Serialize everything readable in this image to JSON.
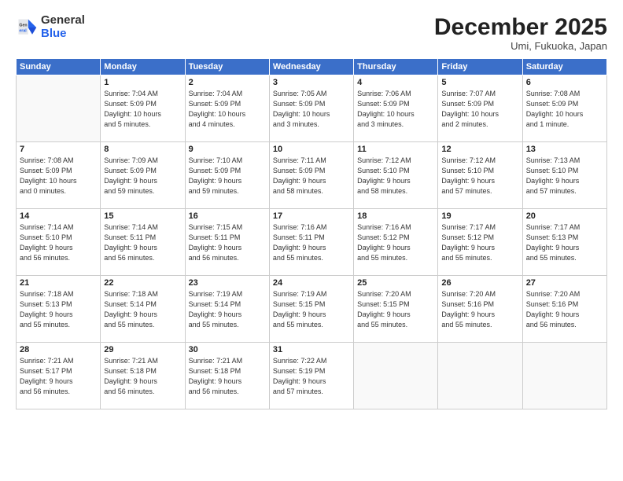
{
  "logo": {
    "general": "General",
    "blue": "Blue"
  },
  "title": "December 2025",
  "subtitle": "Umi, Fukuoka, Japan",
  "days_header": [
    "Sunday",
    "Monday",
    "Tuesday",
    "Wednesday",
    "Thursday",
    "Friday",
    "Saturday"
  ],
  "weeks": [
    [
      {
        "day": "",
        "text": ""
      },
      {
        "day": "1",
        "text": "Sunrise: 7:04 AM\nSunset: 5:09 PM\nDaylight: 10 hours\nand 5 minutes."
      },
      {
        "day": "2",
        "text": "Sunrise: 7:04 AM\nSunset: 5:09 PM\nDaylight: 10 hours\nand 4 minutes."
      },
      {
        "day": "3",
        "text": "Sunrise: 7:05 AM\nSunset: 5:09 PM\nDaylight: 10 hours\nand 3 minutes."
      },
      {
        "day": "4",
        "text": "Sunrise: 7:06 AM\nSunset: 5:09 PM\nDaylight: 10 hours\nand 3 minutes."
      },
      {
        "day": "5",
        "text": "Sunrise: 7:07 AM\nSunset: 5:09 PM\nDaylight: 10 hours\nand 2 minutes."
      },
      {
        "day": "6",
        "text": "Sunrise: 7:08 AM\nSunset: 5:09 PM\nDaylight: 10 hours\nand 1 minute."
      }
    ],
    [
      {
        "day": "7",
        "text": "Sunrise: 7:08 AM\nSunset: 5:09 PM\nDaylight: 10 hours\nand 0 minutes."
      },
      {
        "day": "8",
        "text": "Sunrise: 7:09 AM\nSunset: 5:09 PM\nDaylight: 9 hours\nand 59 minutes."
      },
      {
        "day": "9",
        "text": "Sunrise: 7:10 AM\nSunset: 5:09 PM\nDaylight: 9 hours\nand 59 minutes."
      },
      {
        "day": "10",
        "text": "Sunrise: 7:11 AM\nSunset: 5:09 PM\nDaylight: 9 hours\nand 58 minutes."
      },
      {
        "day": "11",
        "text": "Sunrise: 7:12 AM\nSunset: 5:10 PM\nDaylight: 9 hours\nand 58 minutes."
      },
      {
        "day": "12",
        "text": "Sunrise: 7:12 AM\nSunset: 5:10 PM\nDaylight: 9 hours\nand 57 minutes."
      },
      {
        "day": "13",
        "text": "Sunrise: 7:13 AM\nSunset: 5:10 PM\nDaylight: 9 hours\nand 57 minutes."
      }
    ],
    [
      {
        "day": "14",
        "text": "Sunrise: 7:14 AM\nSunset: 5:10 PM\nDaylight: 9 hours\nand 56 minutes."
      },
      {
        "day": "15",
        "text": "Sunrise: 7:14 AM\nSunset: 5:11 PM\nDaylight: 9 hours\nand 56 minutes."
      },
      {
        "day": "16",
        "text": "Sunrise: 7:15 AM\nSunset: 5:11 PM\nDaylight: 9 hours\nand 56 minutes."
      },
      {
        "day": "17",
        "text": "Sunrise: 7:16 AM\nSunset: 5:11 PM\nDaylight: 9 hours\nand 55 minutes."
      },
      {
        "day": "18",
        "text": "Sunrise: 7:16 AM\nSunset: 5:12 PM\nDaylight: 9 hours\nand 55 minutes."
      },
      {
        "day": "19",
        "text": "Sunrise: 7:17 AM\nSunset: 5:12 PM\nDaylight: 9 hours\nand 55 minutes."
      },
      {
        "day": "20",
        "text": "Sunrise: 7:17 AM\nSunset: 5:13 PM\nDaylight: 9 hours\nand 55 minutes."
      }
    ],
    [
      {
        "day": "21",
        "text": "Sunrise: 7:18 AM\nSunset: 5:13 PM\nDaylight: 9 hours\nand 55 minutes."
      },
      {
        "day": "22",
        "text": "Sunrise: 7:18 AM\nSunset: 5:14 PM\nDaylight: 9 hours\nand 55 minutes."
      },
      {
        "day": "23",
        "text": "Sunrise: 7:19 AM\nSunset: 5:14 PM\nDaylight: 9 hours\nand 55 minutes."
      },
      {
        "day": "24",
        "text": "Sunrise: 7:19 AM\nSunset: 5:15 PM\nDaylight: 9 hours\nand 55 minutes."
      },
      {
        "day": "25",
        "text": "Sunrise: 7:20 AM\nSunset: 5:15 PM\nDaylight: 9 hours\nand 55 minutes."
      },
      {
        "day": "26",
        "text": "Sunrise: 7:20 AM\nSunset: 5:16 PM\nDaylight: 9 hours\nand 55 minutes."
      },
      {
        "day": "27",
        "text": "Sunrise: 7:20 AM\nSunset: 5:16 PM\nDaylight: 9 hours\nand 56 minutes."
      }
    ],
    [
      {
        "day": "28",
        "text": "Sunrise: 7:21 AM\nSunset: 5:17 PM\nDaylight: 9 hours\nand 56 minutes."
      },
      {
        "day": "29",
        "text": "Sunrise: 7:21 AM\nSunset: 5:18 PM\nDaylight: 9 hours\nand 56 minutes."
      },
      {
        "day": "30",
        "text": "Sunrise: 7:21 AM\nSunset: 5:18 PM\nDaylight: 9 hours\nand 56 minutes."
      },
      {
        "day": "31",
        "text": "Sunrise: 7:22 AM\nSunset: 5:19 PM\nDaylight: 9 hours\nand 57 minutes."
      },
      {
        "day": "",
        "text": ""
      },
      {
        "day": "",
        "text": ""
      },
      {
        "day": "",
        "text": ""
      }
    ]
  ]
}
